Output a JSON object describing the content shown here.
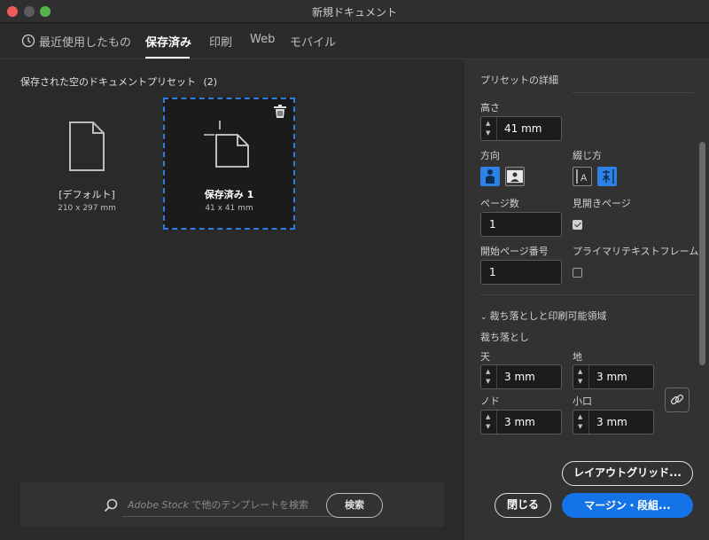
{
  "window": {
    "title": "新規ドキュメント"
  },
  "tabs": [
    {
      "label": "最近使用したもの",
      "icon": "clock-icon"
    },
    {
      "label": "保存済み",
      "active": true
    },
    {
      "label": "印刷"
    },
    {
      "label": "Web"
    },
    {
      "label": "モバイル"
    }
  ],
  "saved": {
    "heading": "保存された空のドキュメントプリセット",
    "count": "(2)",
    "presets": [
      {
        "name": "[デフォルト]",
        "dims": "210 x 297 mm"
      },
      {
        "name": "保存済み 1",
        "dims": "41 x 41 mm"
      }
    ]
  },
  "search": {
    "stock": "Adobe Stock",
    "placeholder": " で他のテンプレートを検索",
    "button": "検索"
  },
  "details": {
    "heading": "プリセットの詳細",
    "height_label": "高さ",
    "height_value": "41 mm",
    "orientation_label": "方向",
    "binding_label": "綴じ方",
    "pages_label": "ページ数",
    "pages_value": "1",
    "facing_label": "見開きページ",
    "facing_checked": true,
    "start_label": "開始ページ番号",
    "start_value": "1",
    "primary_frame_label": "プライマリテキストフレーム",
    "primary_frame_checked": false
  },
  "bleed": {
    "section_title": "裁ち落としと印刷可能領域",
    "sub_label": "裁ち落とし",
    "top_label": "天",
    "top_value": "3 mm",
    "bottom_label": "地",
    "bottom_value": "3 mm",
    "inside_label": "ノド",
    "inside_value": "3 mm",
    "outside_label": "小口",
    "outside_value": "3 mm"
  },
  "buttons": {
    "layout_grid": "レイアウトグリッド...",
    "close": "閉じる",
    "margins": "マージン・段組..."
  },
  "colors": {
    "accent": "#1473e6",
    "selection": "#2f7de1"
  }
}
